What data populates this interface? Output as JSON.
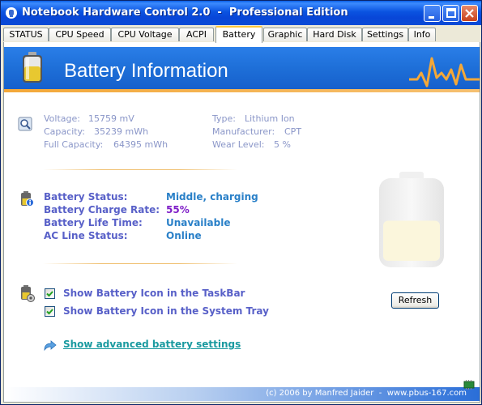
{
  "window": {
    "title": "Notebook Hardware Control 2.0  -  Professional Edition"
  },
  "tabs": [
    {
      "label": "STATUS"
    },
    {
      "label": "CPU Speed"
    },
    {
      "label": "CPU Voltage"
    },
    {
      "label": "ACPI"
    },
    {
      "label": "Battery",
      "active": true
    },
    {
      "label": "Graphic"
    },
    {
      "label": "Hard Disk"
    },
    {
      "label": "Settings"
    },
    {
      "label": "Info"
    }
  ],
  "banner": {
    "title": "Battery Information"
  },
  "info": {
    "voltage_label": "Voltage:",
    "voltage_value": "15759 mV",
    "capacity_label": "Capacity:",
    "capacity_value": "35239 mWh",
    "full_capacity_label": "Full Capacity:",
    "full_capacity_value": "64395 mWh",
    "type_label": "Type:",
    "type_value": "Lithium Ion",
    "manufacturer_label": "Manufacturer:",
    "manufacturer_value": "CPT",
    "wear_level_label": "Wear Level:",
    "wear_level_value": "5 %"
  },
  "status": {
    "battery_status_label": "Battery Status:",
    "battery_status_value": "Middle, charging",
    "charge_rate_label": "Battery Charge Rate:",
    "charge_rate_value": "55%",
    "charge_rate_fraction": 0.55,
    "life_time_label": "Battery Life Time:",
    "life_time_value": "Unavailable",
    "ac_line_label": "AC Line Status:",
    "ac_line_value": "Online"
  },
  "options": {
    "taskbar_icon_label": "Show Battery Icon in the TaskBar",
    "taskbar_icon_checked": true,
    "tray_icon_label": "Show Battery Icon in the System Tray",
    "tray_icon_checked": true,
    "refresh_label": "Refresh",
    "advanced_link": "Show advanced battery settings"
  },
  "footer": {
    "copyright": "(c) 2006 by Manfred Jaider  -  www.pbus-167.com"
  },
  "colors": {
    "title_bar": "#0a53e0",
    "banner": "#1e6fd8",
    "accent_orange": "#f4a838",
    "value_blue": "#2a80c8",
    "value_purple": "#8020c8",
    "label_blue": "#5860c8"
  }
}
